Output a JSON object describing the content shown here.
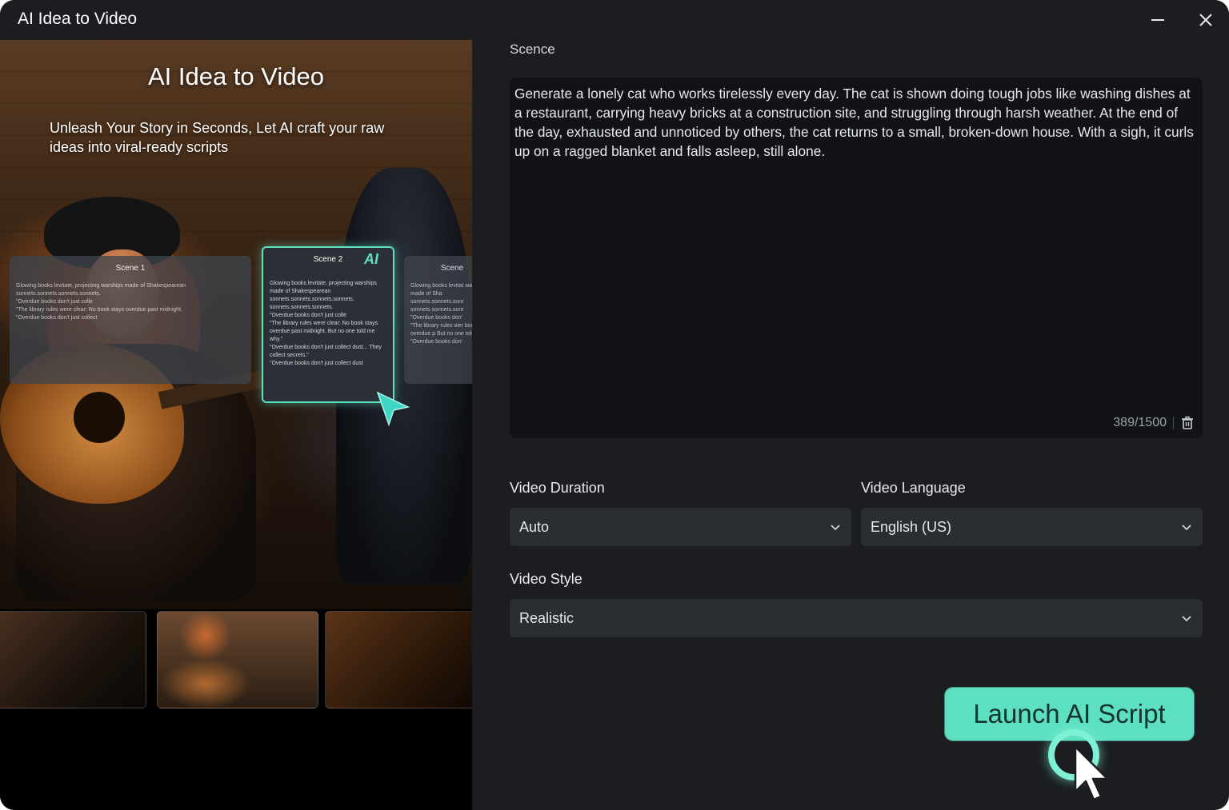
{
  "window": {
    "title": "AI Idea to Video"
  },
  "promo": {
    "title": "AI Idea to Video",
    "subtitle": "Unleash Your Story in Seconds,  Let AI craft your raw ideas into viral-ready scripts",
    "cards": [
      {
        "title": "Scene 1",
        "text": "Glowing books levitate, projecting warships made of Shakespearean sonnets.sonnets.sonnets.sonnets.\n\"Overdue books don't just colle\n\"The library rules were clear: No book stays overdue past midnight.\n\"Overdue books don't just collect"
      },
      {
        "title": "Scene 2",
        "badge": "AI",
        "text": "Glowing books levitate, projecting warships made of Shakespearean sonnets.sonnets.sonnets.sonnets. sonnets.sonnets.sonnets.\n\"Overdue books don't just colle\n\"The library rules were clear: No book stays overdue past midnight. But no one told me why.\"\n\"Overdue books don't just collect dust... They collect secrets.\"\n\"Overdue books don't just collect dust"
      },
      {
        "title": "Scene",
        "text": "Glowing books levitat warships made of Sha sonnets.sonnets.sonr sonnets.sonnets.sonr\n\"Overdue books don'\n\"The library rules wer book stays overdue p But no one told me w\n\"Overdue books don'"
      }
    ]
  },
  "form": {
    "scene_label": "Scence",
    "scene_text": "Generate a lonely cat who works tirelessly every day. The cat is shown doing tough jobs like washing dishes at a restaurant, carrying heavy bricks at a construction site, and struggling through harsh weather. At the end of the day, exhausted and unnoticed by others, the cat returns to a small, broken-down house. With a sigh, it curls up on a ragged blanket and falls asleep, still alone.",
    "counter": "389/1500",
    "duration_label": "Video Duration",
    "duration_value": "Auto",
    "language_label": "Video Language",
    "language_value": "English (US)",
    "style_label": "Video Style",
    "style_value": "Realistic",
    "launch_label": "Launch AI Script"
  },
  "icons": {
    "minimize": "minimize-icon",
    "close": "close-icon",
    "trash": "trash-icon",
    "chevron": "chevron-down-icon",
    "cursor": "cursor-icon"
  },
  "colors": {
    "accent": "#5de0c2",
    "window_bg": "#1b1d21",
    "input_bg": "#2a2d32",
    "textarea_bg": "#111316"
  }
}
